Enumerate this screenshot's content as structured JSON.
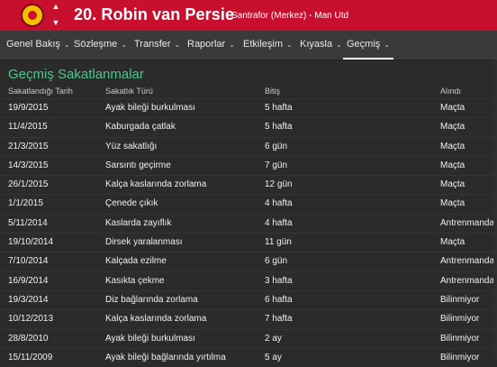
{
  "header": {
    "player_name": "20. Robin van Persie",
    "meta": "Santrafor (Merkez) - Man Utd",
    "accent_color": "#c8102e"
  },
  "nav": {
    "items": [
      {
        "label": "Genel Bakış"
      },
      {
        "label": "Sözleşme"
      },
      {
        "label": "Transfer"
      },
      {
        "label": "Raporlar"
      },
      {
        "label": "Etkileşim"
      },
      {
        "label": "Kıyasla"
      },
      {
        "label": "Geçmiş",
        "active": true
      }
    ]
  },
  "section": {
    "title": "Geçmiş Sakatlanmalar"
  },
  "table": {
    "headers": [
      "Sakatlandığı Tarih",
      "Sakatlık Türü",
      "Bitiş",
      "Alındı"
    ],
    "rows": [
      [
        "19/9/2015",
        "Ayak bileği burkulması",
        "5 hafta",
        "Maçta"
      ],
      [
        "11/4/2015",
        "Kaburgada çatlak",
        "5 hafta",
        "Maçta"
      ],
      [
        "21/3/2015",
        "Yüz sakatlığı",
        "6 gün",
        "Maçta"
      ],
      [
        "14/3/2015",
        "Sarsıntı geçirme",
        "7 gün",
        "Maçta"
      ],
      [
        "26/1/2015",
        "Kalça kaslarında zorlama",
        "12 gün",
        "Maçta"
      ],
      [
        "1/1/2015",
        "Çenede çıkık",
        "4 hafta",
        "Maçta"
      ],
      [
        "5/11/2014",
        "Kaslarda zayıflık",
        "4 hafta",
        "Antrenmanda"
      ],
      [
        "19/10/2014",
        "Dirsek yaralanması",
        "11 gün",
        "Maçta"
      ],
      [
        "7/10/2014",
        "Kalçada ezilme",
        "6 gün",
        "Antrenmanda"
      ],
      [
        "16/9/2014",
        "Kasıkta çekme",
        "3 hafta",
        "Antrenmanda"
      ],
      [
        "19/3/2014",
        "Diz bağlarında zorlama",
        "6 hafta",
        "Bilinmiyor"
      ],
      [
        "10/12/2013",
        "Kalça kaslarında zorlama",
        "7 hafta",
        "Bilinmiyor"
      ],
      [
        "28/8/2010",
        "Ayak bileği burkulması",
        "2 ay",
        "Bilinmiyor"
      ],
      [
        "15/11/2009",
        "Ayak bileği bağlarında yırtılma",
        "5 ay",
        "Bilinmiyor"
      ]
    ]
  }
}
